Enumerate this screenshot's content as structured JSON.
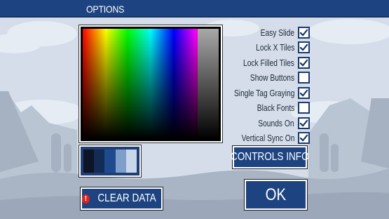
{
  "window": {
    "title": "OPTIONS"
  },
  "color_picker": {
    "swatches": [
      "#0c1426",
      "#142b55",
      "#1f4a8e",
      "#7f9ec9",
      "#c9d7ea"
    ]
  },
  "options": [
    {
      "label": "Easy Slide",
      "checked": true
    },
    {
      "label": "Lock X Tiles",
      "checked": true
    },
    {
      "label": "Lock Filled Tiles",
      "checked": true
    },
    {
      "label": "Show Buttons",
      "checked": false
    },
    {
      "label": "Single Tag Graying",
      "checked": true
    },
    {
      "label": "Black Fonts",
      "checked": false
    },
    {
      "label": "Sounds On",
      "checked": true
    },
    {
      "label": "Vertical Sync On",
      "checked": true
    }
  ],
  "buttons": {
    "controls_info": "CONTROLS INFO",
    "clear_data": "CLEAR DATA",
    "clear_icon": "!",
    "ok": "OK"
  },
  "colors": {
    "accent": "#1d4380",
    "background": "#d2dbe8",
    "landscape": "#a9b4c4"
  },
  "icons": [
    "warning-icon",
    "checkmark-icon"
  ]
}
